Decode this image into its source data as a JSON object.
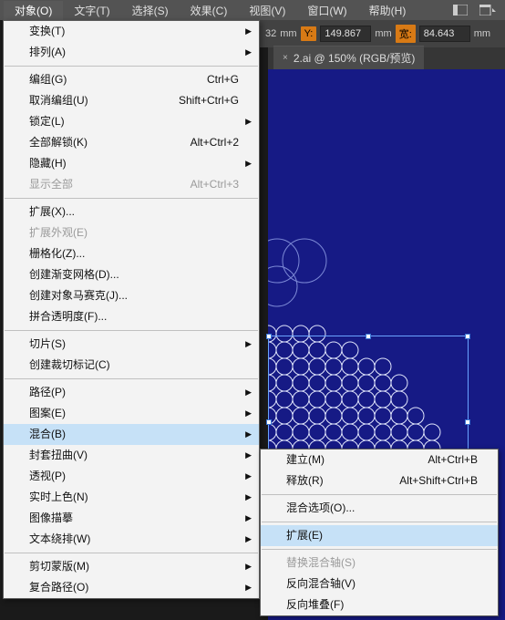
{
  "menubar": {
    "items": [
      "对象(O)",
      "文字(T)",
      "选择(S)",
      "效果(C)",
      "视图(V)",
      "窗口(W)",
      "帮助(H)"
    ],
    "active_index": 0
  },
  "controlbar": {
    "value_y_unit": "mm",
    "label_y": "Y:",
    "value_y": "149.867",
    "label_w": "宽:",
    "value_w": "84.643",
    "unit": "mm",
    "prefix": "32"
  },
  "tab": {
    "label": "2.ai @ 150% (RGB/预览)",
    "close": "×"
  },
  "menu": {
    "groups": [
      [
        {
          "label": "变换(T)",
          "submenu": true
        },
        {
          "label": "排列(A)",
          "submenu": true
        }
      ],
      [
        {
          "label": "编组(G)",
          "shortcut": "Ctrl+G"
        },
        {
          "label": "取消编组(U)",
          "shortcut": "Shift+Ctrl+G"
        },
        {
          "label": "锁定(L)",
          "submenu": true
        },
        {
          "label": "全部解锁(K)",
          "shortcut": "Alt+Ctrl+2"
        },
        {
          "label": "隐藏(H)",
          "submenu": true
        },
        {
          "label": "显示全部",
          "shortcut": "Alt+Ctrl+3",
          "disabled": true
        }
      ],
      [
        {
          "label": "扩展(X)..."
        },
        {
          "label": "扩展外观(E)",
          "disabled": true
        },
        {
          "label": "栅格化(Z)..."
        },
        {
          "label": "创建渐变网格(D)..."
        },
        {
          "label": "创建对象马赛克(J)..."
        },
        {
          "label": "拼合透明度(F)..."
        }
      ],
      [
        {
          "label": "切片(S)",
          "submenu": true
        },
        {
          "label": "创建裁切标记(C)"
        }
      ],
      [
        {
          "label": "路径(P)",
          "submenu": true
        },
        {
          "label": "图案(E)",
          "submenu": true
        },
        {
          "label": "混合(B)",
          "submenu": true,
          "highlight": true
        },
        {
          "label": "封套扭曲(V)",
          "submenu": true
        },
        {
          "label": "透视(P)",
          "submenu": true
        },
        {
          "label": "实时上色(N)",
          "submenu": true
        },
        {
          "label": "图像描摹",
          "submenu": true
        },
        {
          "label": "文本绕排(W)",
          "submenu": true
        }
      ],
      [
        {
          "label": "剪切蒙版(M)",
          "submenu": true
        },
        {
          "label": "复合路径(O)",
          "submenu": true
        }
      ]
    ]
  },
  "submenu": {
    "items": [
      {
        "label": "建立(M)",
        "shortcut": "Alt+Ctrl+B"
      },
      {
        "label": "释放(R)",
        "shortcut": "Alt+Shift+Ctrl+B"
      },
      {
        "sep": true
      },
      {
        "label": "混合选项(O)..."
      },
      {
        "sep": true
      },
      {
        "label": "扩展(E)",
        "highlight": true
      },
      {
        "sep": true
      },
      {
        "label": "替换混合轴(S)",
        "disabled": true
      },
      {
        "label": "反向混合轴(V)"
      },
      {
        "label": "反向堆叠(F)"
      }
    ]
  }
}
